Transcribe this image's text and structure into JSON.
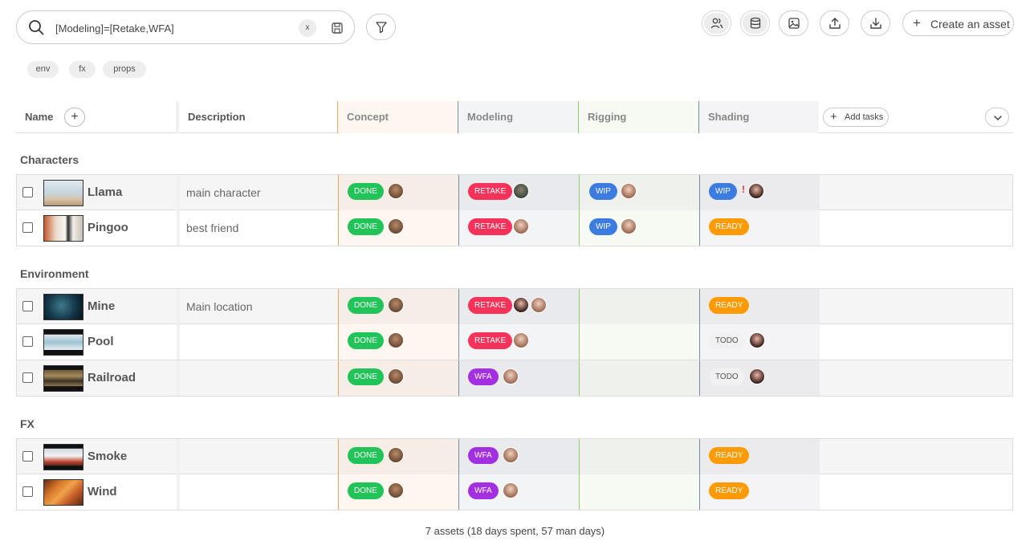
{
  "search": {
    "value": "[Modeling]=[Retake,WFA]",
    "clear_label": "x"
  },
  "toolbar": {
    "create_label": "Create an asset",
    "icons": [
      "people-icon",
      "database-icon",
      "image-icon",
      "upload-icon",
      "download-icon"
    ]
  },
  "chips": [
    "env",
    "fx",
    "props"
  ],
  "columns": {
    "name": "Name",
    "description": "Description",
    "add_tasks_label": "Add tasks",
    "tasks": [
      "Concept",
      "Modeling",
      "Rigging",
      "Shading"
    ]
  },
  "colors": {
    "done": "#22c45a",
    "retake": "#f5335a",
    "wip": "#3c7be0",
    "wfa": "#a330e0",
    "ready": "#ff9a00",
    "todo": "#f1f1f1"
  },
  "groups": [
    {
      "title": "Characters",
      "rows": [
        {
          "name": "Llama",
          "description": "main character",
          "concept": "DONE",
          "modeling": "RETAKE",
          "rigging": "WIP",
          "shading": "WIP"
        },
        {
          "name": "Pingoo",
          "description": "best friend",
          "concept": "DONE",
          "modeling": "RETAKE",
          "rigging": "WIP",
          "shading": "READY"
        }
      ]
    },
    {
      "title": "Environment",
      "rows": [
        {
          "name": "Mine",
          "description": "Main location",
          "concept": "DONE",
          "modeling": "RETAKE",
          "rigging": "",
          "shading": "READY"
        },
        {
          "name": "Pool",
          "description": "",
          "concept": "DONE",
          "modeling": "RETAKE",
          "rigging": "",
          "shading": "TODO"
        },
        {
          "name": "Railroad",
          "description": "",
          "concept": "DONE",
          "modeling": "WFA",
          "rigging": "",
          "shading": "TODO"
        }
      ]
    },
    {
      "title": "FX",
      "rows": [
        {
          "name": "Smoke",
          "description": "",
          "concept": "DONE",
          "modeling": "WFA",
          "rigging": "",
          "shading": "READY"
        },
        {
          "name": "Wind",
          "description": "",
          "concept": "DONE",
          "modeling": "WFA",
          "rigging": "",
          "shading": "READY"
        }
      ]
    }
  ],
  "footer": "7 assets (18 days spent, 57 man days)"
}
